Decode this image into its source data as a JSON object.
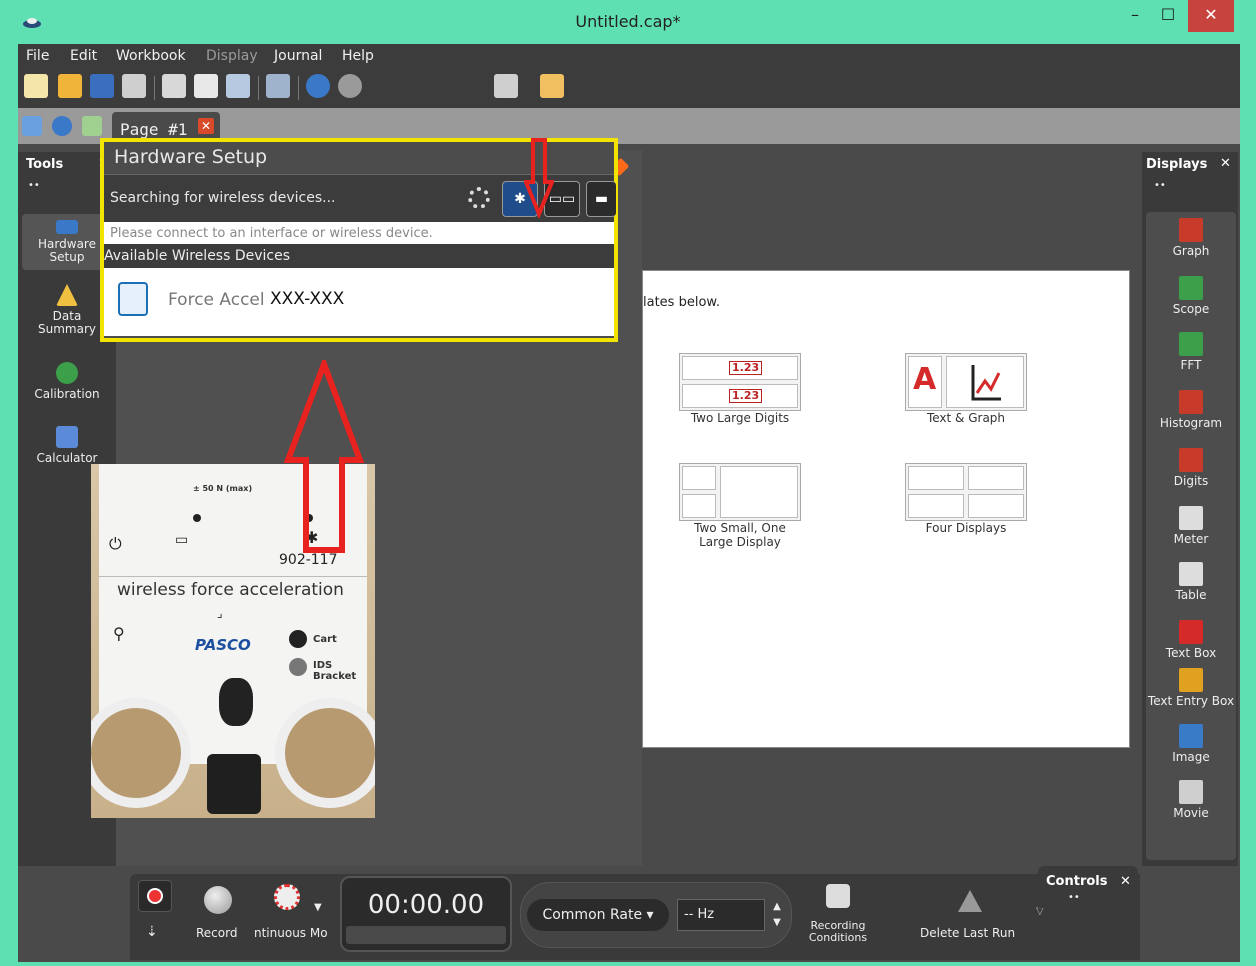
{
  "window": {
    "title": "Untitled.cap*",
    "min": "–",
    "max": "☐",
    "close": "✕"
  },
  "menu": [
    {
      "label": "File",
      "enabled": true
    },
    {
      "label": "Edit",
      "enabled": true
    },
    {
      "label": "Workbook",
      "enabled": true
    },
    {
      "label": "Display",
      "enabled": false
    },
    {
      "label": "Journal",
      "enabled": true
    },
    {
      "label": "Help",
      "enabled": true
    }
  ],
  "page_tab": {
    "label": "Page #1",
    "close": "✕"
  },
  "tools": {
    "title": "Tools",
    "close": "✕",
    "items": [
      {
        "label": "Hardware Setup"
      },
      {
        "label": "Data Summary"
      },
      {
        "label": "Calibration"
      },
      {
        "label": "Calculator"
      }
    ]
  },
  "hardware_setup": {
    "title": "Hardware Setup",
    "status": "Searching for wireless devices...",
    "bluetooth_glyph": "✱",
    "usb_glyph": "▭▭",
    "info": "Please connect to an interface or wireless device.",
    "list_title": "Available Wireless Devices",
    "device": {
      "name": "Force Accel",
      "id": "XXX-XXX"
    }
  },
  "sensor_photo": {
    "range": "± 50 N (max)",
    "model": "902-117",
    "name": "wireless force acceleration",
    "brand": "PASCO",
    "cart": "Cart",
    "ids": "IDS Bracket"
  },
  "page": {
    "hint": "lates below.",
    "templates": [
      {
        "label": "Two Large Digits"
      },
      {
        "label": "Text & Graph"
      },
      {
        "label": "Two Small, One Large Display"
      },
      {
        "label": "Four Displays"
      }
    ],
    "digit_sample": "1.23"
  },
  "displays": {
    "title": "Displays",
    "close": "✕",
    "items": [
      {
        "label": "Graph",
        "color": "#c83a2a"
      },
      {
        "label": "Scope",
        "color": "#3ca04a"
      },
      {
        "label": "FFT",
        "color": "#3ca04a"
      },
      {
        "label": "Histogram",
        "color": "#c83a2a"
      },
      {
        "label": "Digits",
        "color": "#c83a2a"
      },
      {
        "label": "Meter",
        "color": "#dddddd"
      },
      {
        "label": "Table",
        "color": "#dddddd"
      },
      {
        "label": "Text Box",
        "color": "#d52a2a"
      },
      {
        "label": "Text Entry Box",
        "color": "#e0a020"
      },
      {
        "label": "Image",
        "color": "#3a7bc8"
      },
      {
        "label": "Movie",
        "color": "#cfcfcf"
      }
    ]
  },
  "controls": {
    "title": "Controls",
    "close": "✕",
    "record_label": "Record",
    "mode_label": "ntinuous Mo",
    "timer": "00:00.00",
    "rate": "Common Rate ▾",
    "hz": "-- Hz",
    "recording_conditions": "Recording Conditions",
    "delete_last_run": "Delete Last Run"
  },
  "colors": {
    "highlight": "#f2e300",
    "arrow": "#e8231f",
    "titlebar": "#5fe0b3"
  }
}
